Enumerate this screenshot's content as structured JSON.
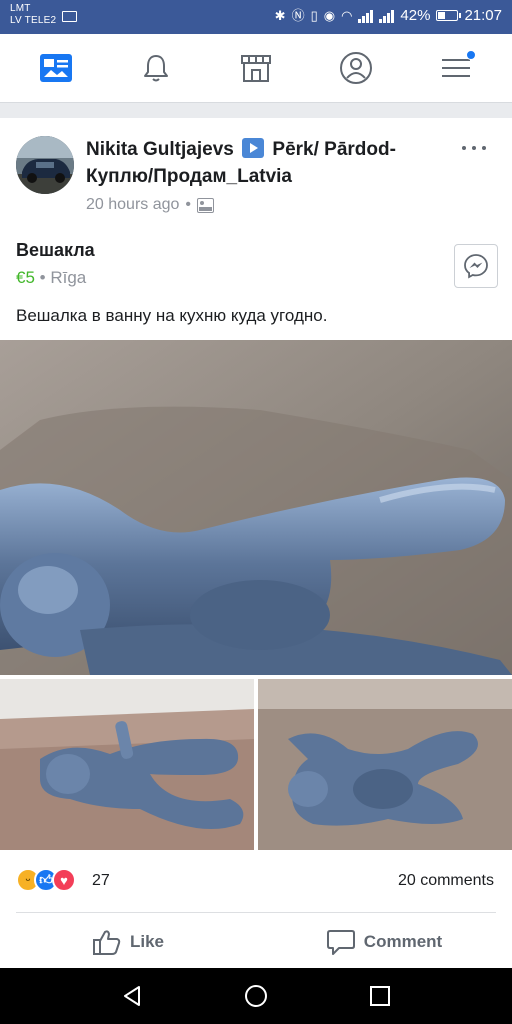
{
  "status_bar": {
    "carrier_line1": "LMT",
    "carrier_line2": "LV TELE2",
    "battery": "42%",
    "battery_level": 0.42,
    "time": "21:07"
  },
  "nav": {
    "items": [
      "news-feed",
      "notifications",
      "marketplace",
      "profile",
      "menu"
    ]
  },
  "post": {
    "author": "Nikita Gultjajevs",
    "group": "Pērk/ Pārdod-Куплю/Продам_Latvia",
    "time": "20 hours ago",
    "separator": "•"
  },
  "listing": {
    "title": "Вешакла",
    "price": "€5",
    "location": "Rīga",
    "description": "Вешалка в ванну на кухню куда угодно."
  },
  "reactions": {
    "count": "27",
    "comments": "20 comments"
  },
  "actions": {
    "like": "Like",
    "comment": "Comment"
  },
  "colors": {
    "brand_blue": "#3b5998",
    "price_green": "#42b72a",
    "meta_gray": "#90949c"
  }
}
